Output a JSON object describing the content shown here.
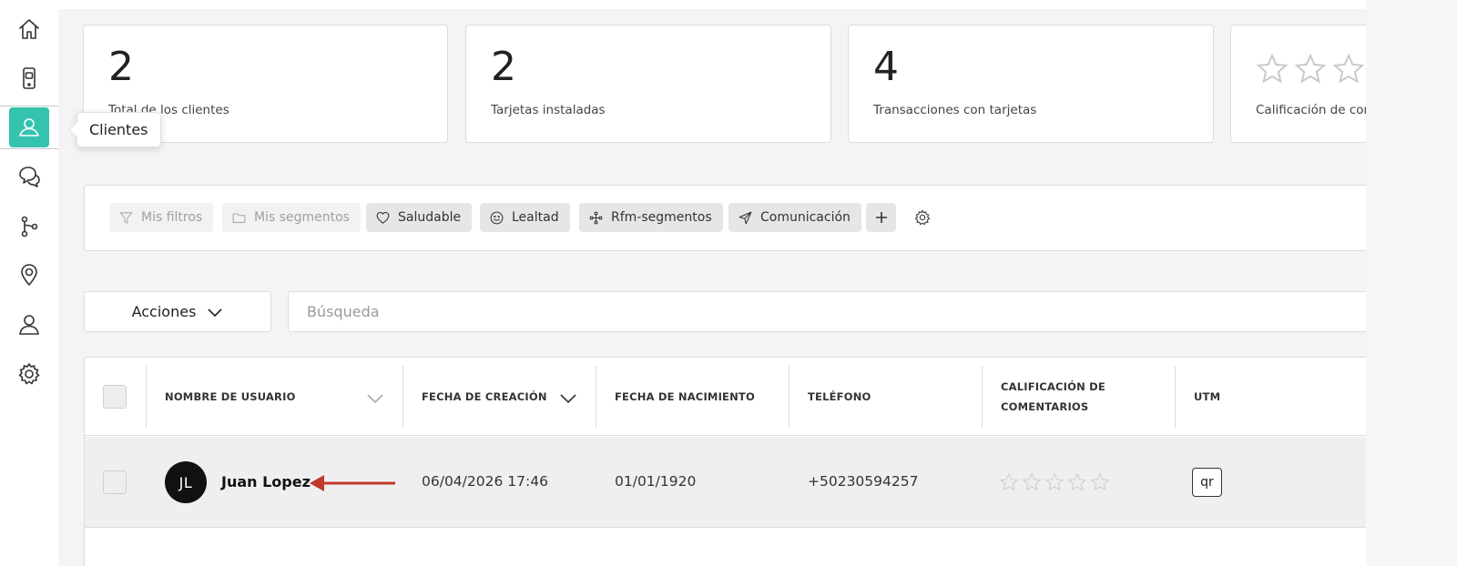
{
  "sidebar": {
    "items": [
      {
        "icon": "home-icon"
      },
      {
        "icon": "mobile-card-icon"
      },
      {
        "icon": "clients-icon",
        "active": true
      },
      {
        "icon": "chat-icon"
      },
      {
        "icon": "branch-icon"
      },
      {
        "icon": "location-pin-icon"
      },
      {
        "icon": "user-profile-icon"
      },
      {
        "icon": "gear-icon"
      }
    ],
    "tooltip": "Clientes",
    "active_color": "#35c3b0"
  },
  "stats": [
    {
      "value": "2",
      "label": "Total de los clientes"
    },
    {
      "value": "2",
      "label": "Tarjetas instaladas"
    },
    {
      "value": "4",
      "label": "Transacciones con tarjetas"
    },
    {
      "value": "",
      "label": "Calificación de comentarios"
    }
  ],
  "filters": {
    "chips": [
      {
        "label": "Mis filtros",
        "icon": "filter-icon",
        "disabled": true
      },
      {
        "label": "Mis segmentos",
        "icon": "folder-icon",
        "disabled": true
      },
      {
        "label": "Saludable",
        "icon": "heart-icon",
        "disabled": false
      },
      {
        "label": "Lealtad",
        "icon": "smile-icon",
        "disabled": false
      },
      {
        "label": "Rfm-segmentos",
        "icon": "segments-icon",
        "disabled": false
      },
      {
        "label": "Comunicación",
        "icon": "send-icon",
        "disabled": false
      }
    ]
  },
  "toolbar": {
    "actions_label": "Acciones",
    "search_placeholder": "Búsqueda"
  },
  "table": {
    "columns": [
      "NOMBRE DE USUARIO",
      "FECHA DE CREACIÓN",
      "FECHA DE NACIMIENTO",
      "TELÉFONO",
      "CALIFICACIÓN DE COMENTARIOS",
      "UTM"
    ],
    "rows": [
      {
        "initials": "JL",
        "name": "Juan Lopez",
        "created": "06/04/2026 17:46",
        "birthdate": "01/01/1920",
        "phone": "+50230594257",
        "rating": 0,
        "utm": "qr"
      }
    ]
  },
  "annotation": {
    "arrow_color": "#c0392b"
  }
}
